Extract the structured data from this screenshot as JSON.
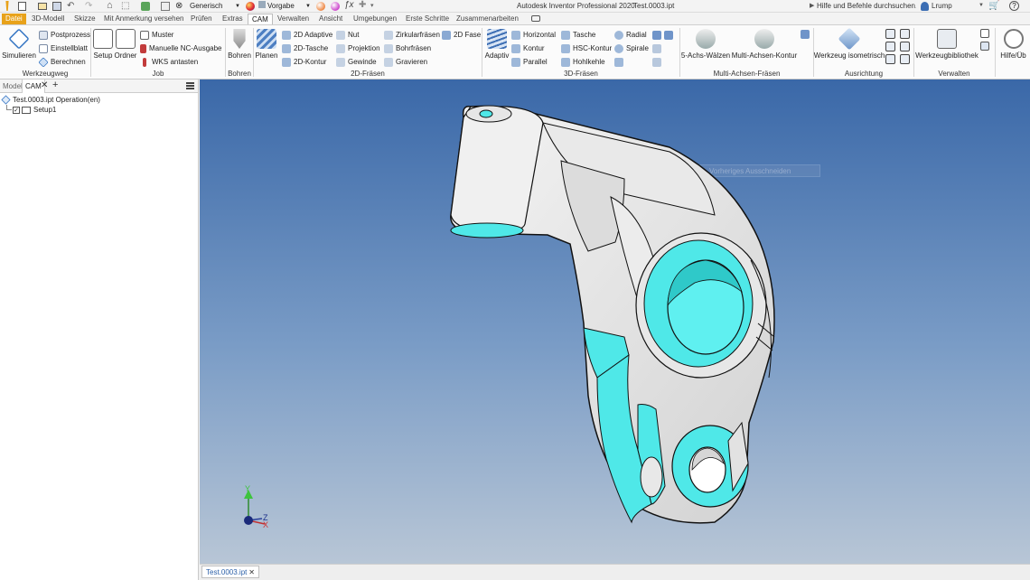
{
  "titlebar": {
    "style_value": "Generisch",
    "appearance_value": "Vorgabe",
    "app_title": "Autodesk Inventor Professional 2020",
    "doc_title": "Test.0003.ipt",
    "search_placeholder": "Hilfe und Befehle durchsuchen...",
    "user": "Lrump"
  },
  "tabs": [
    "Datei",
    "3D-Modell",
    "Skizze",
    "Mit Anmerkung versehen",
    "Prüfen",
    "Extras",
    "CAM",
    "Verwalten",
    "Ansicht",
    "Umgebungen",
    "Erste Schritte",
    "Zusammenarbeiten"
  ],
  "ribbon": {
    "werkzeugweg": {
      "label": "Werkzeugweg",
      "simulieren": "Simulieren",
      "postprozess": "Postprozess",
      "einstellblatt": "Einstellblatt",
      "berechnen": "Berechnen"
    },
    "job": {
      "label": "Job",
      "setup": "Setup",
      "ordner": "Ordner",
      "muster": "Muster",
      "manuelle": "Manuelle NC-Ausgabe",
      "wks": "WKS antasten"
    },
    "bohren": {
      "label": "Bohren",
      "bohren": "Bohren"
    },
    "fraesen2d": {
      "label": "2D-Fräsen",
      "planen": "Planen",
      "adaptive": "2D Adaptive",
      "tasche": "2D-Tasche",
      "kontur": "2D-Kontur",
      "nut": "Nut",
      "projektion": "Projektion",
      "gewinde": "Gewinde",
      "zirkular": "Zirkularfräsen",
      "bohrfraesen": "Bohrfräsen",
      "gravieren": "Gravieren",
      "fase": "2D Fase"
    },
    "fraesen3d": {
      "label": "3D-Fräsen",
      "adaptiv": "Adaptiv",
      "horizontal": "Horizontal",
      "kontur": "Kontur",
      "parallel": "Parallel",
      "tasche": "Tasche",
      "hsc": "HSC-Kontur",
      "hohlkehle": "Hohlkehle",
      "radial": "Radial",
      "spirale": "Spirale"
    },
    "multiachsen": {
      "label": "Multi-Achsen-Fräsen",
      "walzen": "5-Achs-Wälzen",
      "kontur": "Multi-Achsen-Kontur"
    },
    "ausrichtung": {
      "label": "Ausrichtung",
      "iso": "Werkzeug isometrisch"
    },
    "verwalten": {
      "label": "Verwalten",
      "bibliothek": "Werkzeugbibliothek"
    },
    "hilfe": {
      "label": "Hilfe/Üb"
    }
  },
  "panel": {
    "tabs": [
      "Modell",
      "CAM"
    ],
    "root": "Test.0003.ipt Operation(en)",
    "setup": "Setup1"
  },
  "viewport": {
    "tooltip": "Vorheriges Ausschneiden"
  },
  "triad": {
    "x": "X",
    "y": "Y",
    "z": "Z"
  },
  "doctab": "Test.0003.ipt",
  "colors": {
    "cam_cyan": "#4fe8e8",
    "file_tab": "#e8a21a",
    "background_top": "#3a68a8",
    "background_bottom": "#b8c6d6"
  }
}
